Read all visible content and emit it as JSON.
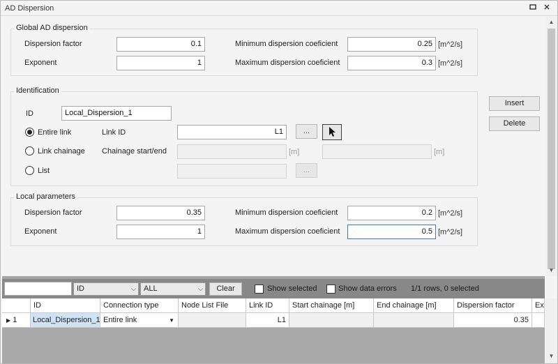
{
  "window": {
    "title": "AD Dispersion"
  },
  "global": {
    "title": "Global AD dispersion",
    "dispersion_factor_label": "Dispersion factor",
    "dispersion_factor_value": "0.1",
    "exponent_label": "Exponent",
    "exponent_value": "1",
    "min_label": "Minimum dispersion coeficient",
    "min_value": "0.25",
    "min_unit": "[m^2/s]",
    "max_label": "Maximum dispersion coeficient",
    "max_value": "0.3",
    "max_unit": "[m^2/s]"
  },
  "identification": {
    "title": "Identification",
    "id_label": "ID",
    "id_value": "Local_Dispersion_1",
    "entire_link_label": "Entire link",
    "link_id_label": "Link ID",
    "link_id_value": "L1",
    "browse_label": "...",
    "link_chainage_label": "Link chainage",
    "chainage_label": "Chainage start/end",
    "chainage_unit_start": "[m]",
    "chainage_unit_end": "[m]",
    "list_label": "List",
    "list_browse_label": "..."
  },
  "actions": {
    "insert_label": "Insert",
    "delete_label": "Delete"
  },
  "local": {
    "title": "Local parameters",
    "dispersion_factor_label": "Dispersion factor",
    "dispersion_factor_value": "0.35",
    "exponent_label": "Exponent",
    "exponent_value": "1",
    "min_label": "Minimum dispersion coeficient",
    "min_value": "0.2",
    "min_unit": "[m^2/s]",
    "max_label": "Maximum dispersion coeficient",
    "max_value": "0.5",
    "max_unit": "[m^2/s]"
  },
  "grid_toolbar": {
    "search_value": "",
    "column_select": "ID",
    "filter_select": "ALL",
    "clear_label": "Clear",
    "show_selected_label": "Show selected",
    "show_errors_label": "Show data errors",
    "status_text": "1/1 rows, 0 selected"
  },
  "table": {
    "columns": [
      "ID",
      "Connection type",
      "Node List File",
      "Link ID",
      "Start chainage [m]",
      "End chainage [m]",
      "Dispersion factor",
      "Ex"
    ],
    "rows": [
      {
        "num": "1",
        "id": "Local_Dispersion_1",
        "connection_type": "Entire link",
        "node_list_file": "",
        "link_id": "L1",
        "start_chainage": "",
        "end_chainage": "",
        "dispersion_factor": "0.35"
      }
    ]
  },
  "colors": {
    "focus": "#3c7fb1",
    "selection": "#cfe3f5",
    "toolbar_bg": "#888888",
    "grid_bg": "#a9a9a9"
  }
}
